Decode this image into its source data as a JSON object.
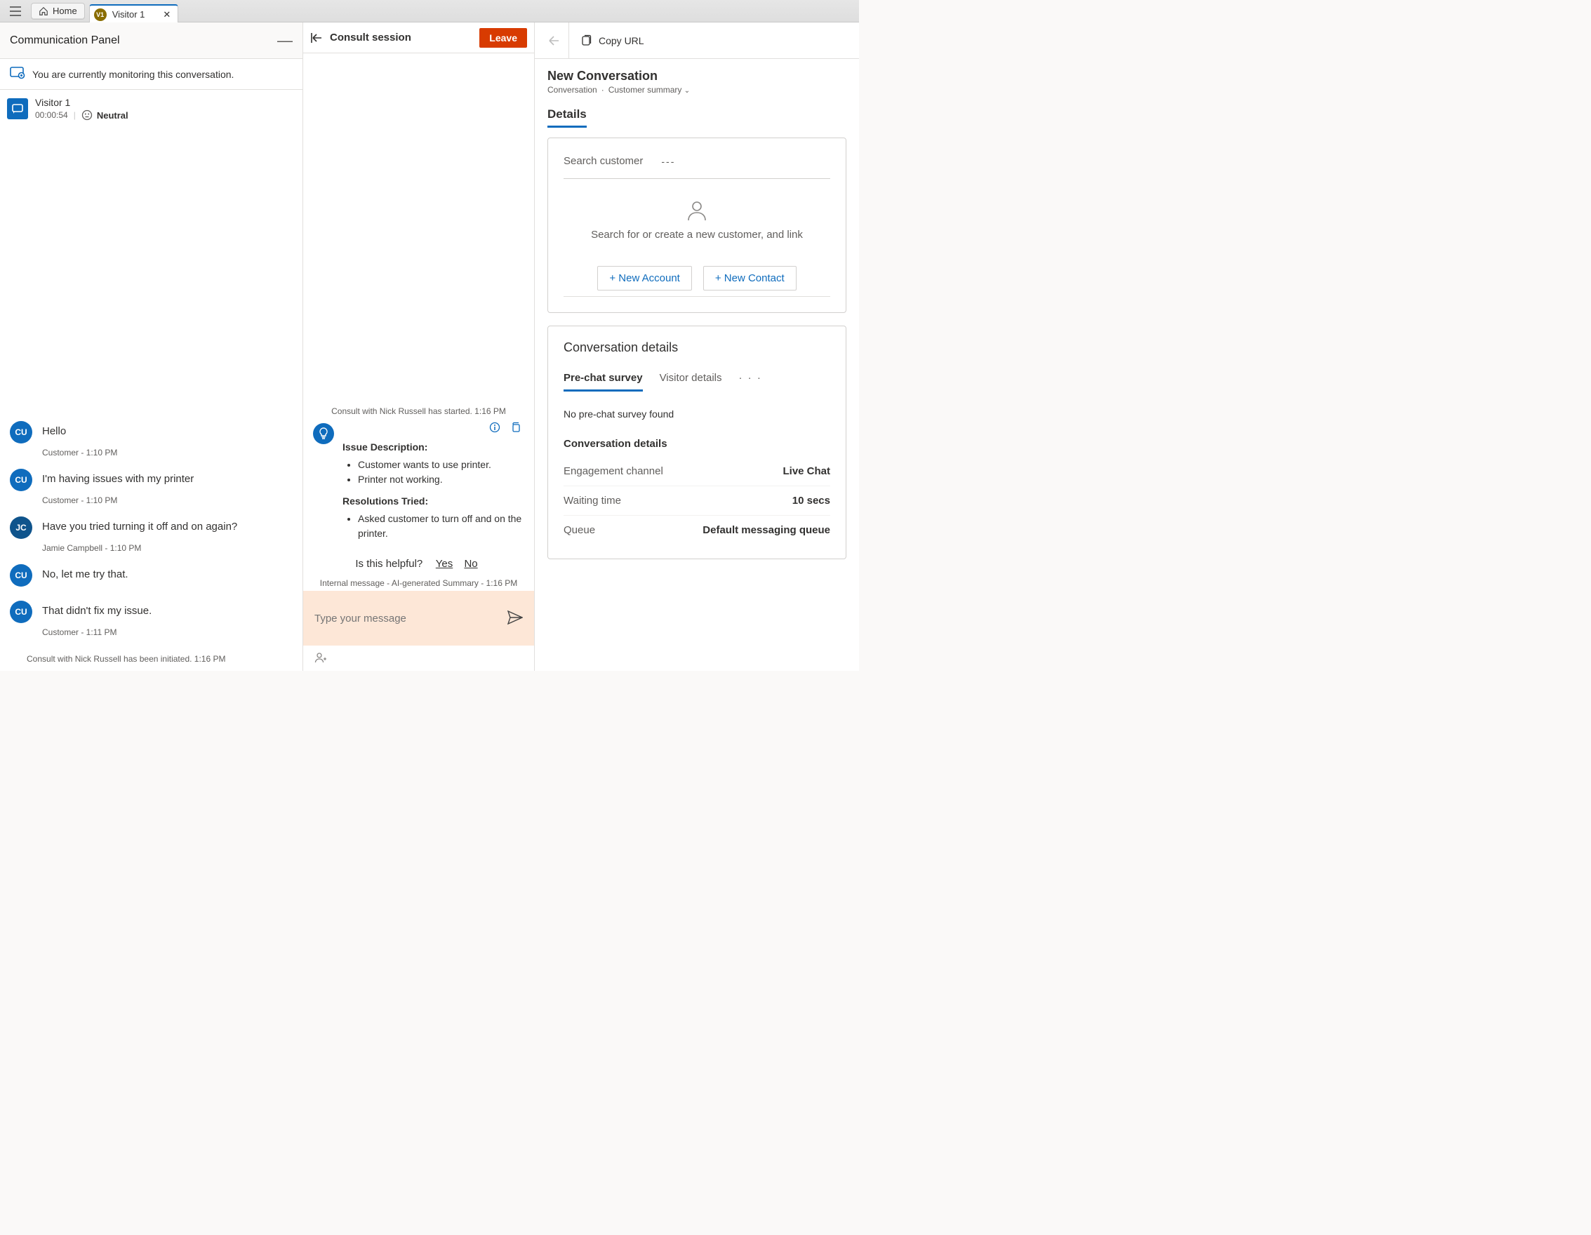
{
  "topbar": {
    "home_label": "Home",
    "session_tab": {
      "avatar_text": "V1",
      "label": "Visitor 1",
      "close_glyph": "✕"
    }
  },
  "commpanel": {
    "title": "Communication Panel",
    "monitor_text": "You are currently monitoring this conversation.",
    "visitor": {
      "name": "Visitor 1",
      "timer": "00:00:54",
      "sentiment": "Neutral"
    }
  },
  "consult": {
    "title": "Consult session",
    "leave": "Leave",
    "started_note": "Consult with Nick Russell has started. 1:16 PM",
    "ai": {
      "issue_title": "Issue Description:",
      "issue_items": [
        "Customer wants to use printer.",
        "Printer not working."
      ],
      "res_title": "Resolutions Tried:",
      "res_items": [
        "Asked customer to turn off and on the printer."
      ],
      "helpful_q": "Is this helpful?",
      "yes": "Yes",
      "no": "No",
      "internal_meta": "Internal message - AI-generated Summary - 1:16 PM"
    },
    "compose_placeholder": "Type your message"
  },
  "chat": {
    "messages": [
      {
        "avatar": "CU",
        "avatarClass": "av-cu",
        "text": "Hello",
        "meta": "Customer - 1:10 PM"
      },
      {
        "avatar": "CU",
        "avatarClass": "av-cu",
        "text": "I'm having issues with my printer",
        "meta": "Customer - 1:10 PM"
      },
      {
        "avatar": "JC",
        "avatarClass": "av-jc",
        "text": "Have you tried turning it off and on again?",
        "meta": "Jamie Campbell - 1:10 PM"
      },
      {
        "avatar": "CU",
        "avatarClass": "av-cu",
        "text": "No, let me try that.",
        "meta": ""
      },
      {
        "avatar": "CU",
        "avatarClass": "av-cu",
        "text": "That didn't fix my issue.",
        "meta": "Customer - 1:11 PM"
      }
    ],
    "consult_initiated": "Consult with Nick Russell has been initiated. 1:16 PM"
  },
  "right": {
    "copy_url": "Copy URL",
    "title": "New Conversation",
    "crumb1": "Conversation",
    "crumb2": "Customer summary",
    "details_tab": "Details",
    "search": {
      "label": "Search customer",
      "value": "---",
      "empty_text": "Search for or create a new customer, and link",
      "new_account": "+ New Account",
      "new_contact": "+ New Contact"
    },
    "conv_details": {
      "header": "Conversation details",
      "tab1": "Pre-chat survey",
      "tab2": "Visitor details",
      "more": "· · ·",
      "no_survey": "No pre-chat survey found",
      "rows": [
        {
          "k": "Engagement channel",
          "v": "Live Chat"
        },
        {
          "k": "Waiting time",
          "v": "10 secs"
        },
        {
          "k": "Queue",
          "v": "Default messaging queue"
        }
      ]
    }
  }
}
